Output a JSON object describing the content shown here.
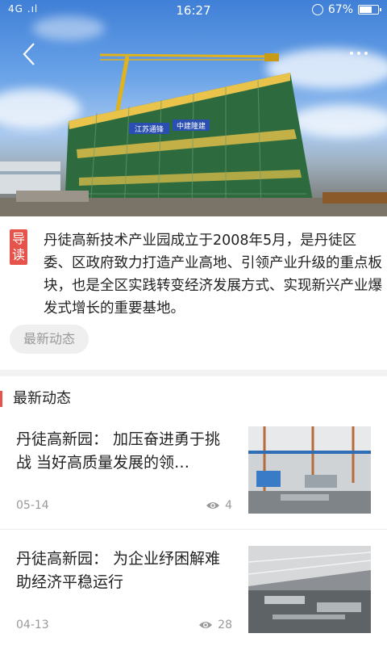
{
  "status": {
    "signal": "4G .ıl",
    "time": "16:27",
    "battery": "67%"
  },
  "hero": {
    "sign_left": "江苏通锋",
    "sign_right": "中建隆建"
  },
  "intro": {
    "tag": "导读",
    "text": "丹徒高新技术产业园成立于2008年5月，是丹徒区委、区政府致力打造产业高地、引领产业升级的重点板块，也是全区实践转变经济发展方式、实现新兴产业爆发式增长的重要基地。",
    "chip": "最新动态"
  },
  "section": {
    "title": "最新动态"
  },
  "news": [
    {
      "title": "丹徒高新园： 加压奋进勇于挑战 当好高质量发展的领…",
      "date": "05-14",
      "views": "4"
    },
    {
      "title": "丹徒高新园： 为企业纾困解难 助经济平稳运行",
      "date": "04-13",
      "views": "28"
    }
  ],
  "colors": {
    "accent": "#e5534b",
    "muted": "#999999"
  },
  "icons": [
    "back-icon",
    "more-icon",
    "eye-icon"
  ]
}
